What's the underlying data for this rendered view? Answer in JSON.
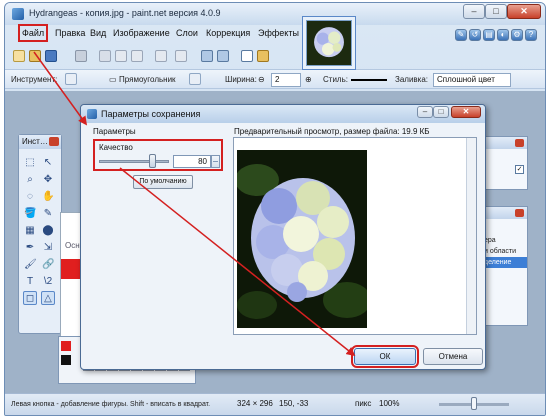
{
  "window": {
    "title": "Hydrangeas - копия.jpg - paint.net версия 4.0.9",
    "min_label": "–",
    "max_label": "□",
    "close_label": "✕"
  },
  "menu": {
    "items": [
      "Файл",
      "Правка",
      "Вид",
      "Изображение",
      "Слои",
      "Коррекция",
      "Эффекты"
    ]
  },
  "toolbar": {
    "tool_label": "Инструмент:",
    "shape_value": "Прямоугольник",
    "width_label": "Ширина:",
    "width_value": "2",
    "style_label": "Стиль:",
    "fill_label": "Заливка:",
    "fill_value": "Сплошной цвет"
  },
  "tools_palette": {
    "title": "Инст…",
    "tools": [
      "⬚",
      "↖",
      "⌕",
      "✥",
      "◌",
      "✋",
      "🪣",
      "✎",
      "▦",
      "⬤",
      "✒",
      "⇲",
      "🖌",
      "🔗",
      "T",
      "\\2",
      "◻",
      "△"
    ]
  },
  "behind": {
    "tab_label": "Осно",
    "right_rows": [
      "ера",
      "и области",
      "деление"
    ]
  },
  "dialog": {
    "title": "Параметры сохранения",
    "params_label": "Параметры",
    "preview_label": "Предварительный просмотр, размер файла: 19.9 КБ",
    "quality_label": "Качество",
    "quality_value": "80",
    "quality_fraction": 0.8,
    "default_button": "По умолчанию",
    "ok_button": "ОК",
    "cancel_button": "Отмена",
    "min_label": "–",
    "max_label": "□",
    "close_label": "✕"
  },
  "status": {
    "hint": "Левая кнопка - добавление фигуры. Shift - вписать в квадрат.",
    "size": "324 × 296",
    "position": "150, -33",
    "unit": "пикс",
    "zoom": "100%"
  },
  "colors": {
    "accent": "#d42020",
    "selection": "#3d7fd6",
    "palette": [
      "#e01f1f",
      "#ff8c1a",
      "#ffe01a",
      "#37c837",
      "#1fb0e0",
      "#2a46d6",
      "#a32ad6",
      "#ffffff",
      "#000000"
    ]
  }
}
